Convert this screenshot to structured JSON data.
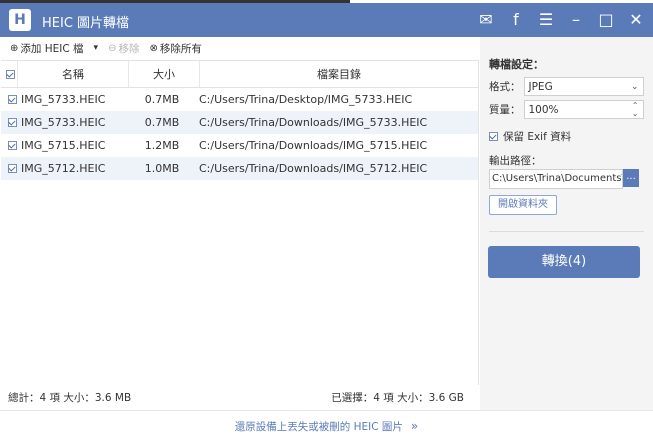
{
  "app": {
    "title": "HEIC 圖片轉檔",
    "logo": "H"
  },
  "window_icons": {
    "message": "✉",
    "facebook": "f",
    "menu": "☰",
    "minimize": "–",
    "maximize": "□",
    "close": "✕"
  },
  "toolbar": {
    "add_label": "添加 HEIC 檔",
    "remove_label": "移除",
    "remove_all_label": "移除所有"
  },
  "table": {
    "columns": {
      "name": "名稱",
      "size": "大小",
      "path": "檔案目錄"
    },
    "rows": [
      {
        "name": "IMG_5733.HEIC",
        "size": "0.7MB",
        "path": "C:/Users/Trina/Desktop/IMG_5733.HEIC"
      },
      {
        "name": "IMG_5733.HEIC",
        "size": "0.7MB",
        "path": "C:/Users/Trina/Downloads/IMG_5733.HEIC"
      },
      {
        "name": "IMG_5715.HEIC",
        "size": "1.2MB",
        "path": "C:/Users/Trina/Downloads/IMG_5715.HEIC"
      },
      {
        "name": "IMG_5712.HEIC",
        "size": "1.0MB",
        "path": "C:/Users/Trina/Downloads/IMG_5712.HEIC"
      }
    ]
  },
  "status": {
    "total": "總計：4 項 大小：3.6 MB",
    "selected": "已選擇：4 項 大小：3.6 GB"
  },
  "footer": {
    "link": "還原設備上丟失或被刪的 HEIC 圖片",
    "arrow": "»"
  },
  "settings": {
    "title": "轉檔設定：",
    "format_label": "格式：",
    "format_value": "JPEG",
    "quality_label": "質量：",
    "quality_value": "100%",
    "exif_label": "保留 Exif 資料",
    "output_label": "輸出路徑：",
    "output_path": "C:\\Users\\Trina\\Documents\\",
    "browse_label": "...",
    "open_folder_label": "開啟資料夾",
    "convert_label": "轉換(4)"
  },
  "colors": {
    "accent": "#5b7bb8",
    "row_alt": "#eef2f9"
  }
}
